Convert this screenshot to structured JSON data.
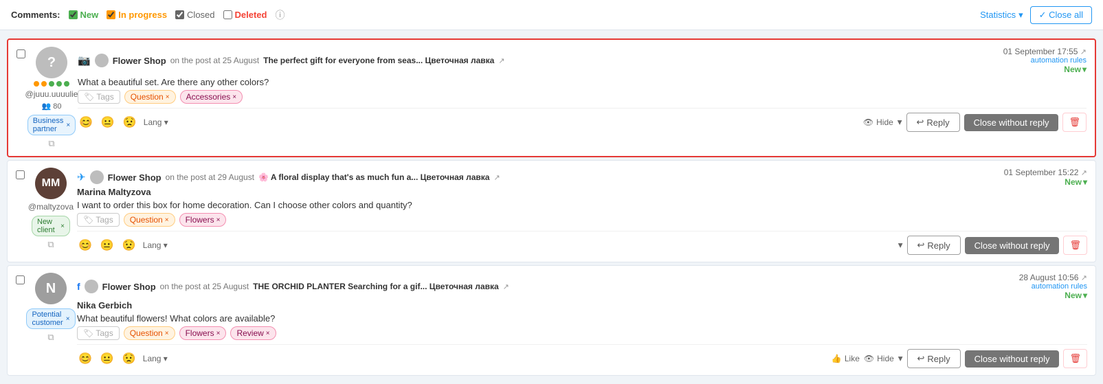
{
  "topbar": {
    "label": "Comments:",
    "filters": [
      {
        "id": "new",
        "label": "New",
        "checked": true,
        "colorClass": "color-new",
        "checkboxClass": "checkbox-new"
      },
      {
        "id": "inprogress",
        "label": "In progress",
        "checked": true,
        "colorClass": "color-inprog",
        "checkboxClass": "checkbox-inprog"
      },
      {
        "id": "closed",
        "label": "Closed",
        "checked": true,
        "colorClass": "color-closed",
        "checkboxClass": "checkbox-closed"
      },
      {
        "id": "deleted",
        "label": "Deleted",
        "checked": false,
        "colorClass": "color-deleted",
        "checkboxClass": "checkbox-deleted"
      }
    ],
    "statistics_label": "Statistics",
    "close_all_label": "✓ Close all"
  },
  "comments": [
    {
      "id": "c1",
      "highlighted": true,
      "source_icon": "📷",
      "source_icon_class": "source-icon-ig",
      "avatar_bg": "#bdbdbd",
      "avatar_letter": "?",
      "avatar_img": null,
      "followers_dots": 5,
      "username": "@juuu.uuuulie",
      "shop_name": "Flower Shop",
      "post_date": "25 August",
      "post_title": "The perfect gift for everyone from seas... Цветочная лавка",
      "comment_text": "What a beautiful set. Are there any other colors?",
      "tags": [
        {
          "label": "Question",
          "class": "tag-question"
        },
        {
          "label": "Accessories",
          "class": "tag-accessories"
        }
      ],
      "badges": [
        {
          "label": "Business partner",
          "class": "badge-business"
        }
      ],
      "timestamp": "01 September 17:55",
      "auto_rules": "automation rules",
      "status": "New",
      "has_hide": true,
      "has_like": false,
      "show_expand_left": false
    },
    {
      "id": "c2",
      "highlighted": false,
      "source_icon": "✈",
      "source_icon_class": "source-icon-tg",
      "avatar_bg": "#555",
      "avatar_letter": "M",
      "avatar_img": "marina",
      "followers_dots": 0,
      "username": "@maltyzova",
      "display_name": "Marina Maltyzova",
      "shop_name": "Flower Shop",
      "post_date": "29 August",
      "post_title": "🌸 A floral display that's as much fun a... Цветочная лавка",
      "comment_text": "I want to order this box for home decoration. Can I choose other colors and quantity?",
      "tags": [
        {
          "label": "Question",
          "class": "tag-question"
        },
        {
          "label": "Flowers",
          "class": "tag-flowers"
        }
      ],
      "badges": [
        {
          "label": "New client",
          "class": "badge-newclient"
        }
      ],
      "timestamp": "01 September 15:22",
      "auto_rules": "",
      "status": "New",
      "has_hide": false,
      "has_like": false,
      "show_expand_left": true
    },
    {
      "id": "c3",
      "highlighted": false,
      "source_icon": "f",
      "source_icon_class": "source-icon-fb",
      "avatar_bg": "#9e9e9e",
      "avatar_letter": "N",
      "avatar_img": null,
      "followers_dots": 0,
      "username": "",
      "display_name": "Nika Gerbich",
      "shop_name": "Flower Shop",
      "post_date": "25 August",
      "post_title": "THE ORCHID PLANTER Searching for a gif... Цветочная лавка",
      "comment_text": "What beautiful flowers! What colors are available?",
      "tags": [
        {
          "label": "Question",
          "class": "tag-question"
        },
        {
          "label": "Flowers",
          "class": "tag-flowers"
        },
        {
          "label": "Review",
          "class": "tag-review"
        }
      ],
      "badges": [
        {
          "label": "Potential customer",
          "class": "badge-potential"
        }
      ],
      "timestamp": "28 August 10:56",
      "auto_rules": "automation rules",
      "status": "New",
      "has_hide": true,
      "has_like": true,
      "show_expand_left": false
    }
  ],
  "labels": {
    "tags": "Tags",
    "lang": "Lang",
    "hide": "Hide",
    "reply": "Reply",
    "close_without_reply": "Close without reply",
    "like": "Like",
    "on_post": "on the post at",
    "followers": "80",
    "chevron_down": "▾"
  }
}
